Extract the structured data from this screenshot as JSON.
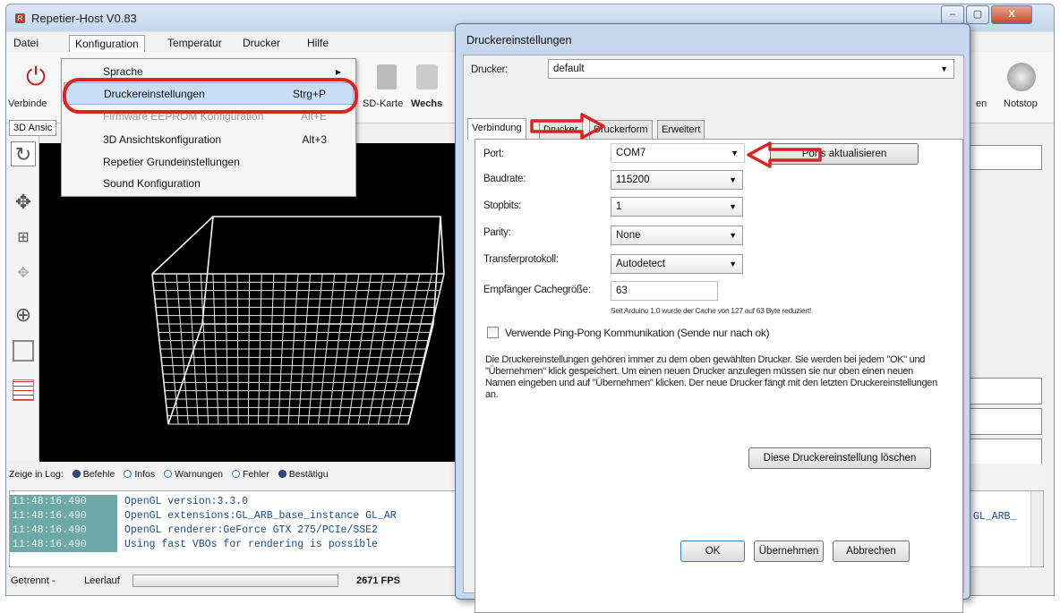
{
  "window": {
    "title": "Repetier-Host V0.83",
    "minimize": "–",
    "maximize": "▢",
    "close": "X"
  },
  "menubar": [
    "Datei",
    "Konfiguration",
    "Temperatur",
    "Drucker",
    "Hilfe"
  ],
  "toolbar": {
    "connect": "Verbinde",
    "sdcard": "SD-Karte",
    "wechsel": "Wechs",
    "right_label": "en",
    "notstop": "Notstop"
  },
  "view_tab": "3D Ansic",
  "dropdown": [
    {
      "label": "Sprache",
      "shortcut": "▸"
    },
    {
      "label": "Druckereinstellungen",
      "shortcut": "Strg+P"
    },
    {
      "label": "Firmware EEPROM Konfiguration",
      "shortcut": "Alt+E"
    },
    {
      "label": "3D Ansichtskonfiguration",
      "shortcut": "Alt+3"
    },
    {
      "label": "Repetier Grundeinstellungen",
      "shortcut": ""
    },
    {
      "label": "Sound Konfiguration",
      "shortcut": ""
    }
  ],
  "log": {
    "filter_label": "Zeige in Log:",
    "filters": [
      {
        "label": "Befehle",
        "color": "#2b4a86"
      },
      {
        "label": "Infos",
        "color": "#3a7bd5"
      },
      {
        "label": "Warnungen",
        "color": "#3a7bd5"
      },
      {
        "label": "Fehler",
        "color": "#3a7bd5"
      },
      {
        "label": "Bestätigu",
        "color": "#2b4a86"
      }
    ],
    "lines": [
      {
        "time": "11:48:16.490",
        "msg": "OpenGL version:3.3.0"
      },
      {
        "time": "11:48:16.490",
        "msg": "OpenGL extensions:GL_ARB_base_instance GL_AR"
      },
      {
        "time": "11:48:16.490",
        "msg": "OpenGL renderer:GeForce GTX 275/PCIe/SSE2"
      },
      {
        "time": "11:48:16.490",
        "msg": "Using fast VBOs for rendering is possible"
      }
    ],
    "right_text": "GL_ARB_"
  },
  "status": {
    "connection": "Getrennt -",
    "state": "Leerlauf",
    "fps": "2671 FPS"
  },
  "dialog": {
    "title": "Druckereinstellungen",
    "printer_label": "Drucker:",
    "printer_value": "default",
    "tabs": [
      "Verbindung",
      "Drucker",
      "Druckerform",
      "Erweitert"
    ],
    "port_label": "Port:",
    "port_value": "COM7",
    "refresh_ports": "Ports aktualisieren",
    "baud_label": "Baudrate:",
    "baud_value": "115200",
    "stopbits_label": "Stopbits:",
    "stopbits_value": "1",
    "parity_label": "Parity:",
    "parity_value": "None",
    "protocol_label": "Transferprotokoll:",
    "protocol_value": "Autodetect",
    "cache_label": "Empfänger Cachegröße:",
    "cache_value": "63",
    "cache_note": "Seit Arduino 1.0 wurde der Cache von 127 auf 63 Byte reduziert!",
    "pingpong_label": "Verwende Ping-Pong Kommunikation (Sende nur nach ok)",
    "info_text": "Die Druckereinstellungen gehören immer zu dem oben gewählten Drucker. Sie werden bei jedem \"OK\" und \"Übernehmen\" klick gespeichert. Um einen neuen Drucker anzulegen müssen sie nur oben einen neuen Namen eingeben und auf \"Übernehmen\" klicken. Der neue Drucker fängt mit den letzten Druckereinstellungen an.",
    "delete_btn": "Diese Druckereinstellung löschen",
    "ok": "OK",
    "apply": "Übernehmen",
    "cancel": "Abbrechen"
  },
  "colors": {
    "accent_red": "#d22222",
    "highlight": "#c9def5"
  }
}
